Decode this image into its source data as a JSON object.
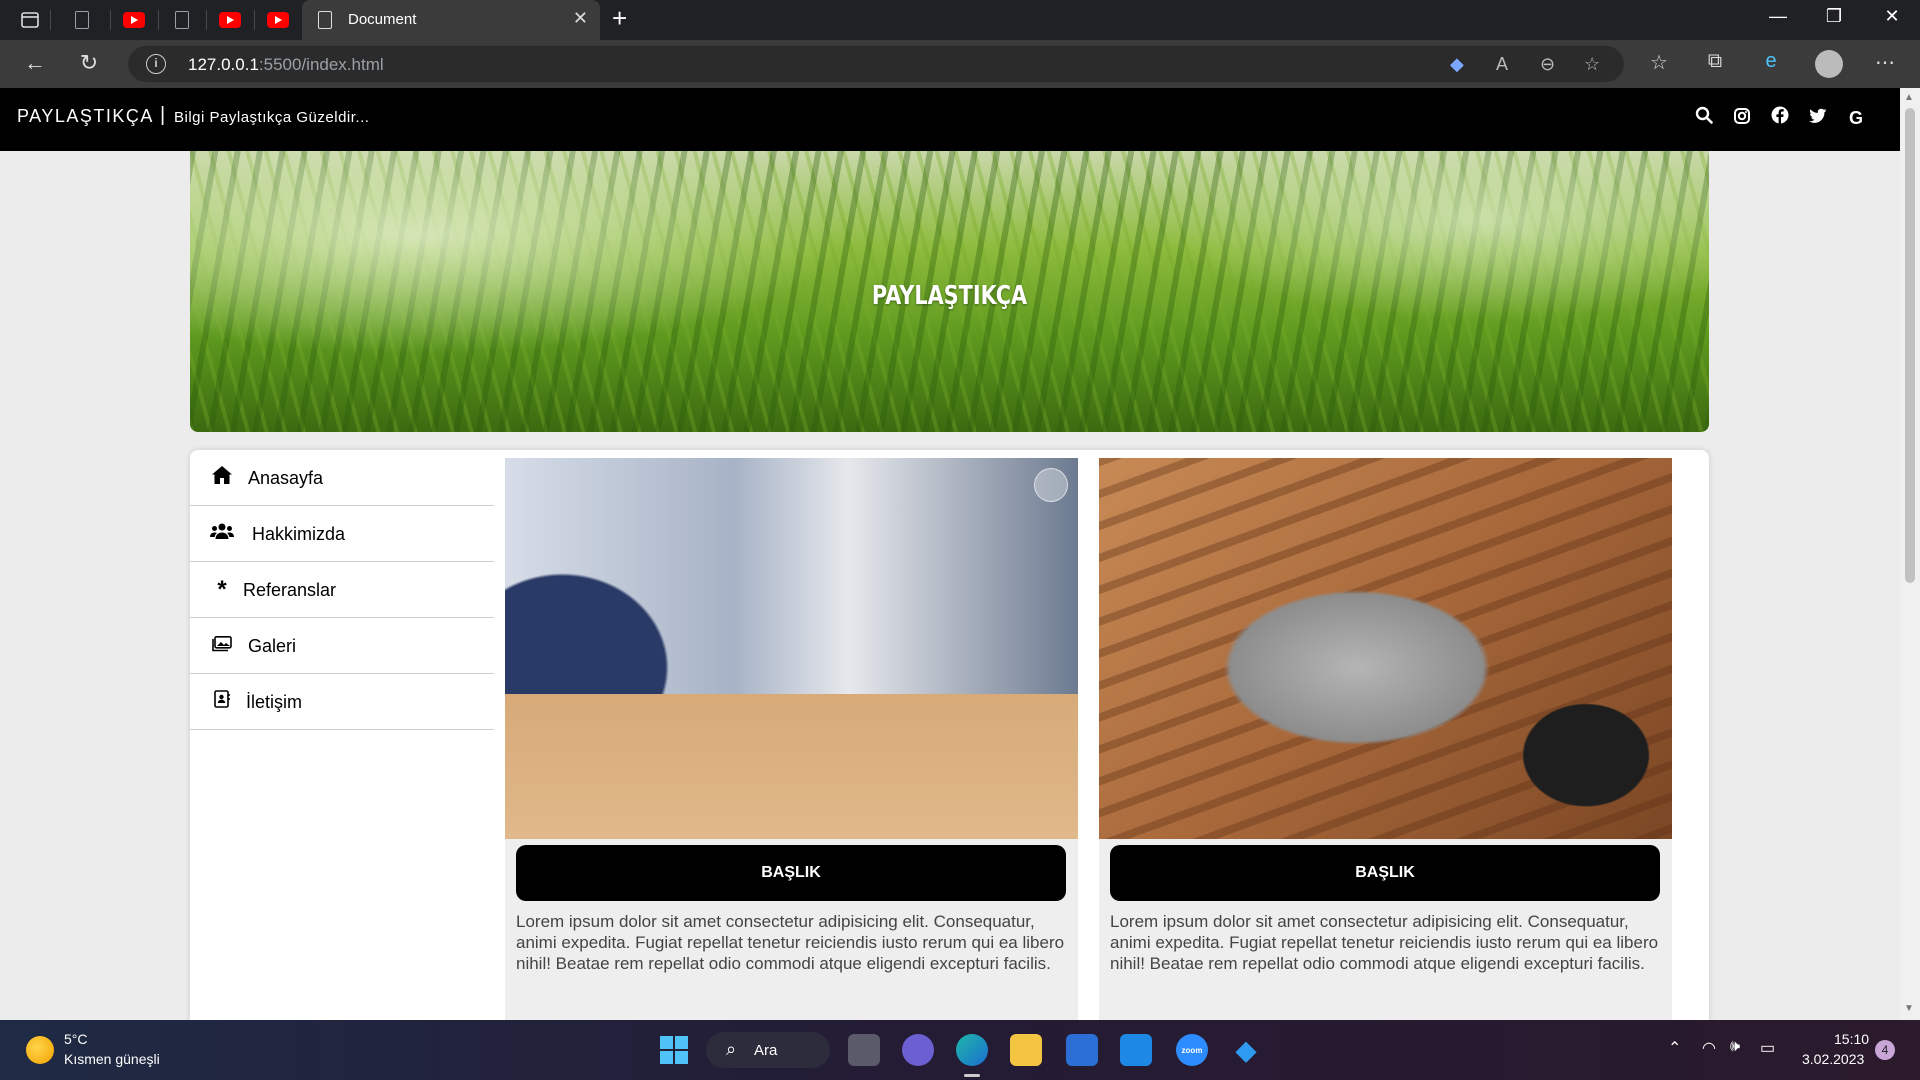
{
  "browser": {
    "active_tab_title": "Document",
    "tab_close_icon": "close-icon",
    "new_tab_label": "+",
    "url_host": "127.0.0.1",
    "url_rest": ":5500/index.html",
    "window_controls": {
      "minimize": "—",
      "restore": "❐",
      "close": "✕"
    }
  },
  "site": {
    "brand": "PAYLAŞTIKÇA",
    "brand_separator": "|",
    "tagline": "Bilgi Paylaştıkça Güzeldir...",
    "hero_title": "PAYLAŞTIKÇA",
    "social_icons": [
      "search-icon",
      "instagram-icon",
      "facebook-icon",
      "twitter-icon",
      "google-icon"
    ],
    "menu": [
      {
        "label": "Anasayfa",
        "icon": "home-icon"
      },
      {
        "label": "Hakkimizda",
        "icon": "users-icon"
      },
      {
        "label": "Referanslar",
        "icon": "asterisk-icon"
      },
      {
        "label": "Galeri",
        "icon": "gallery-icon"
      },
      {
        "label": "İletişim",
        "icon": "contact-card-icon"
      }
    ],
    "cards": [
      {
        "heading": "BAŞLIK",
        "text": "Lorem ipsum dolor sit amet consectetur adipisicing elit. Consequatur, animi expedita. Fugiat repellat tenetur reiciendis iusto rerum qui ea libero nihil! Beatae rem repellat odio commodi atque eligendi excepturi facilis."
      },
      {
        "heading": "BAŞLIK",
        "text": "Lorem ipsum dolor sit amet consectetur adipisicing elit. Consequatur, animi expedita. Fugiat repellat tenetur reiciendis iusto rerum qui ea libero nihil! Beatae rem repellat odio commodi atque eligendi excepturi facilis."
      }
    ]
  },
  "taskbar": {
    "weather_temp": "5°C",
    "weather_desc": "Kısmen güneşli",
    "search_label": "Ara",
    "time": "15:10",
    "date": "3.02.2023",
    "notification_count": "4"
  },
  "colors": {
    "header_bg": "#000000",
    "page_bg": "#ececec",
    "card_button": "#1a5fb4"
  }
}
